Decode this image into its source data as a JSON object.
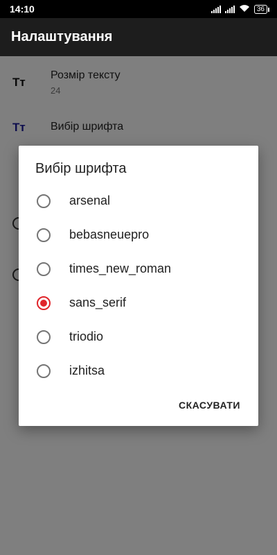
{
  "status_bar": {
    "time": "14:10",
    "battery": "36"
  },
  "app_bar": {
    "title": "Налаштування"
  },
  "settings": {
    "items": [
      {
        "icon": "text-size-icon",
        "icon_glyph": "Тт",
        "title": "Розмір тексту",
        "subtitle": "24"
      },
      {
        "icon": "font-select-icon",
        "icon_glyph": "Тт",
        "title": "Вибір шрифта"
      }
    ]
  },
  "dialog": {
    "title": "Вибір шрифта",
    "options": [
      {
        "label": "arsenal",
        "checked": false
      },
      {
        "label": "bebasneuepro",
        "checked": false
      },
      {
        "label": "times_new_roman",
        "checked": false
      },
      {
        "label": "sans_serif",
        "checked": true
      },
      {
        "label": "triodio",
        "checked": false
      },
      {
        "label": "izhitsa",
        "checked": false
      }
    ],
    "cancel_label": "СКАСУВАТИ"
  },
  "colors": {
    "accent": "#e0242a",
    "app_bar": "#1d1d1d",
    "icon_blue": "#1a1a9a"
  }
}
